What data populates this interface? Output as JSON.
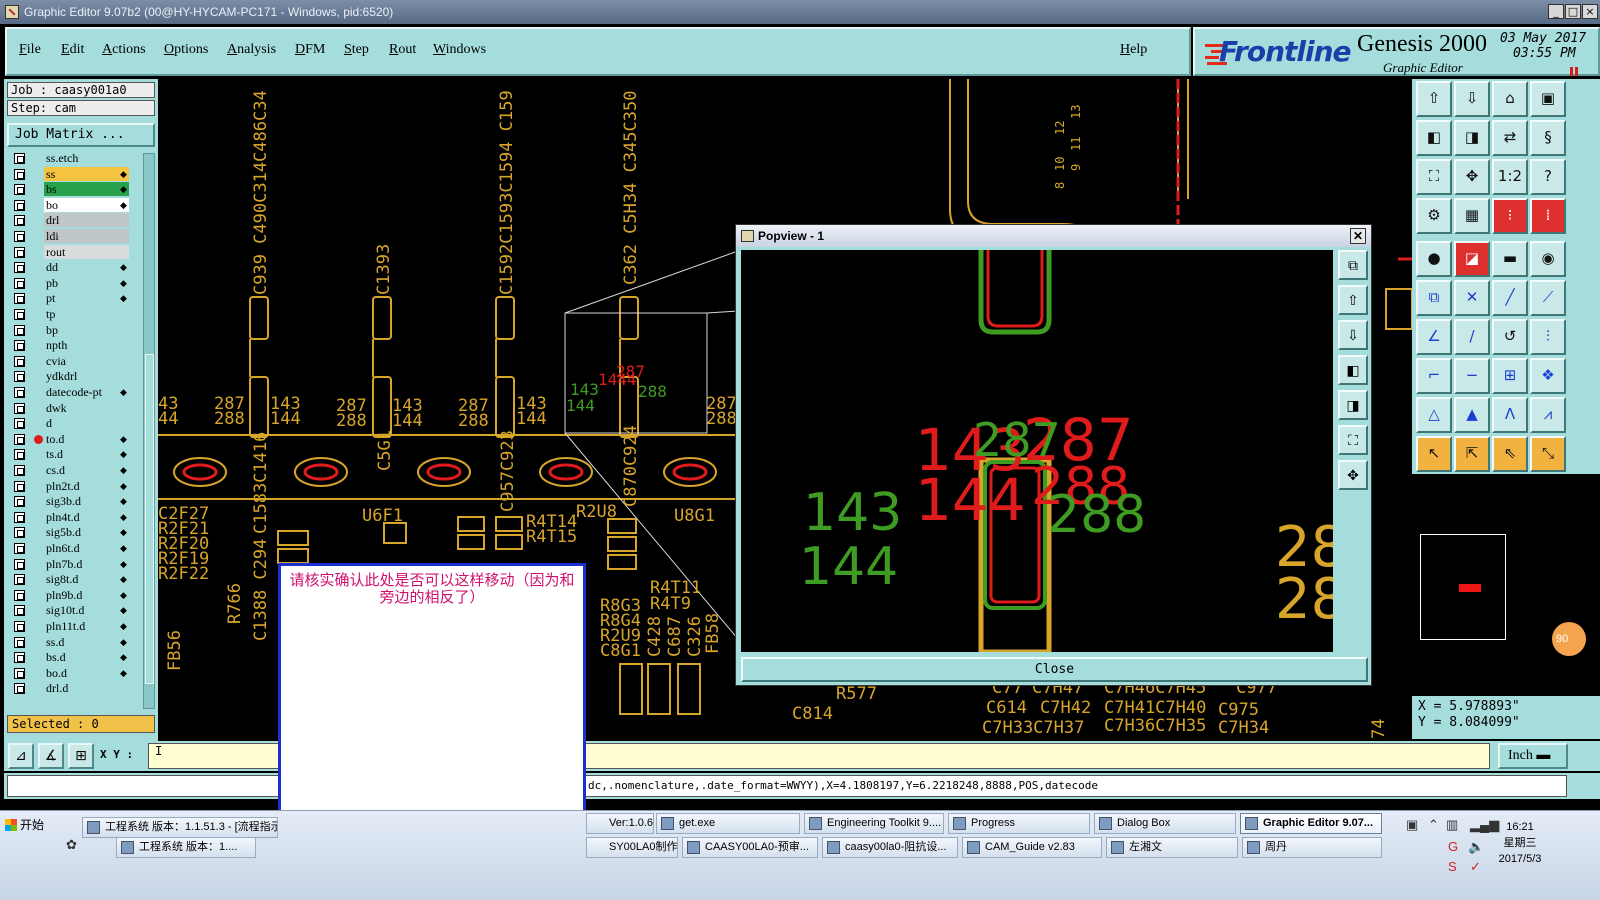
{
  "window": {
    "title": "Graphic Editor 9.07b2 (00@HY-HYCAM-PC171 - Windows, pid:6520)",
    "controls": [
      "_",
      "□",
      "×"
    ]
  },
  "menu": [
    "File",
    "Edit",
    "Actions",
    "Options",
    "Analysis",
    "DFM",
    "Step",
    "Rout",
    "Windows"
  ],
  "help_label": "Help",
  "logo": {
    "brand": "Frontline",
    "product": "Genesis 2000",
    "subtitle": "Graphic Editor",
    "date": "03 May 2017",
    "time": "03:55 PM"
  },
  "job": {
    "job_line": "Job : caasy001a0",
    "step_line": "Step: cam",
    "matrix_button": "Job Matrix ..."
  },
  "layers": [
    {
      "name": "ss.etch",
      "color": "#a5dcdc",
      "tick": false
    },
    {
      "name": "ss",
      "color": "#f5c440",
      "tick": true
    },
    {
      "name": "bs",
      "color": "#27a14b",
      "tick": true
    },
    {
      "name": "bo",
      "color": "#ffffff",
      "tick": true
    },
    {
      "name": "drl",
      "color": "#bfc6c8",
      "tick": false
    },
    {
      "name": "ldi",
      "color": "#bfc6c8",
      "tick": false
    },
    {
      "name": "rout",
      "color": "#d8dcdc",
      "tick": false
    },
    {
      "name": "dd",
      "color": "#a5dcdc",
      "tick": true
    },
    {
      "name": "pb",
      "color": "#a5dcdc",
      "tick": true
    },
    {
      "name": "pt",
      "color": "#a5dcdc",
      "tick": true
    },
    {
      "name": "tp",
      "color": "#a5dcdc",
      "tick": false
    },
    {
      "name": "bp",
      "color": "#a5dcdc",
      "tick": false
    },
    {
      "name": "npth",
      "color": "#a5dcdc",
      "tick": false
    },
    {
      "name": "cvia",
      "color": "#a5dcdc",
      "tick": false
    },
    {
      "name": "ydkdrl",
      "color": "#a5dcdc",
      "tick": false
    },
    {
      "name": "datecode-pt",
      "color": "#a5dcdc",
      "tick": true
    },
    {
      "name": "dwk",
      "color": "#a5dcdc",
      "tick": false
    },
    {
      "name": "d",
      "color": "#a5dcdc",
      "tick": false
    },
    {
      "name": "to.d",
      "color": "#a5dcdc",
      "tick": true,
      "dot": true
    },
    {
      "name": "ts.d",
      "color": "#a5dcdc",
      "tick": true
    },
    {
      "name": "cs.d",
      "color": "#a5dcdc",
      "tick": true
    },
    {
      "name": "pln2t.d",
      "color": "#a5dcdc",
      "tick": true
    },
    {
      "name": "sig3b.d",
      "color": "#a5dcdc",
      "tick": true
    },
    {
      "name": "pln4t.d",
      "color": "#a5dcdc",
      "tick": true
    },
    {
      "name": "sig5b.d",
      "color": "#a5dcdc",
      "tick": true
    },
    {
      "name": "pln6t.d",
      "color": "#a5dcdc",
      "tick": true
    },
    {
      "name": "pln7b.d",
      "color": "#a5dcdc",
      "tick": true
    },
    {
      "name": "sig8t.d",
      "color": "#a5dcdc",
      "tick": true
    },
    {
      "name": "pln9b.d",
      "color": "#a5dcdc",
      "tick": true
    },
    {
      "name": "sig10t.d",
      "color": "#a5dcdc",
      "tick": true
    },
    {
      "name": "pln11t.d",
      "color": "#a5dcdc",
      "tick": true
    },
    {
      "name": "ss.d",
      "color": "#a5dcdc",
      "tick": true
    },
    {
      "name": "bs.d",
      "color": "#a5dcdc",
      "tick": true
    },
    {
      "name": "bo.d",
      "color": "#a5dcdc",
      "tick": true
    },
    {
      "name": "drl.d",
      "color": "#a5dcdc",
      "tick": false
    }
  ],
  "selected": "Selected : 0",
  "bottom": {
    "xy_label": "X Y :",
    "cmd_value": "I",
    "unit": "Inch",
    "status": "dc,.nomenclature,.date_format=WWYY),X=4.1808197,Y=6.2218248,8888,POS,datecode"
  },
  "coords": {
    "x": "X = 5.978893\"",
    "y": "Y = 8.084099\""
  },
  "popview": {
    "title": "Popview - 1",
    "close_label": "Close",
    "labels": [
      "143",
      "144",
      "287",
      "288"
    ]
  },
  "note": {
    "text": "请核实确认此处是否可以这样移动（因为和旁边的相反了）"
  },
  "pcb_labels": {
    "rotated": [
      "C939 C490C314C486C34",
      "C1393",
      "C1592C1593C1594 C159",
      "C362 C5H34 C345C350",
      "C5G1",
      "C957C923",
      "C870C924",
      "C1583C1416",
      "C1388 C294",
      "R766",
      "FB56",
      "FB58"
    ],
    "plain": [
      "43",
      "44",
      "287",
      "288",
      "143",
      "144",
      "287",
      "288",
      "143",
      "144",
      "287",
      "288",
      "143",
      "144",
      "287",
      "288",
      "C2F27",
      "R2F21",
      "R2F20",
      "R2F19",
      "R2F22",
      "U6F1",
      "R4T14",
      "R4T15",
      "R2U8",
      "U8G1",
      "R4T11",
      "R4T9",
      "R8G3",
      "R8G4",
      "R2U9",
      "C8G1",
      "C428",
      "C687",
      "C326",
      "R577",
      "C814",
      "C614",
      "C7H42",
      "C7H41C7H40",
      "C975",
      "C7H33C7H37",
      "C7H36C7H35",
      "C7H34",
      "C77",
      "C7H47",
      "C7H46C7H45",
      "C977",
      "74"
    ],
    "mini": [
      "143",
      "144",
      "1444",
      "287",
      "288"
    ],
    "ruler": [
      "13",
      "12",
      "11",
      "10",
      "9",
      "8"
    ]
  },
  "colors": {
    "panel": "#a5dcdc",
    "pad_yellow": "#d7a52a",
    "green": "#3f9c22",
    "red": "#e01b1b"
  },
  "taskbar": {
    "start": "开始",
    "row1": [
      "工程系统 版本：1.1.51.3 - [流程指示",
      "Ver:1.0.6)",
      "get.exe",
      "Engineering Toolkit 9....",
      "Progress",
      "Dialog Box",
      "Graphic Editor 9.07..."
    ],
    "row2": [
      "工程系统 版本：1....",
      "SY00LA0制作单....",
      "CAASY00LA0-预审...",
      "caasy00la0-阻抗设...",
      "CAM_Guide v2.83",
      "左湘文",
      "周丹"
    ],
    "clock_time": "16:21",
    "clock_day": "星期三",
    "clock_date": "2017/5/3"
  }
}
